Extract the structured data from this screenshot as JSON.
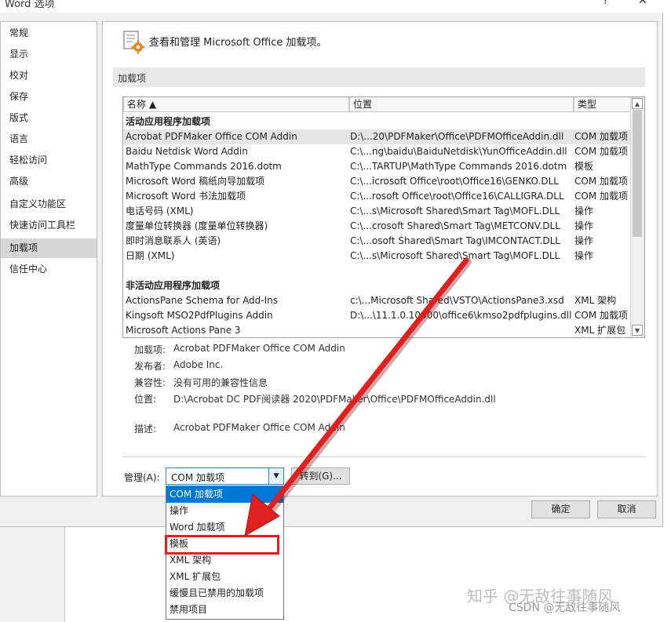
{
  "window": {
    "title": "Word 选项",
    "help": "?",
    "close": "✕"
  },
  "nav": {
    "items": [
      {
        "label": "常规"
      },
      {
        "label": "显示"
      },
      {
        "label": "校对"
      },
      {
        "label": "保存"
      },
      {
        "label": "版式"
      },
      {
        "label": "语言"
      },
      {
        "label": "轻松访问"
      },
      {
        "label": "高级"
      },
      {
        "label": "自定义功能区"
      },
      {
        "label": "快速访问工具栏"
      },
      {
        "label": "加载项"
      },
      {
        "label": "信任中心"
      }
    ],
    "selected": "加载项"
  },
  "header": {
    "text": "查看和管理 Microsoft Office 加载项。",
    "icon": "addin-gear-icon"
  },
  "section": {
    "label": "加载项"
  },
  "grid": {
    "columns": [
      "名称 ▲",
      "位置",
      "类型"
    ],
    "rows": [
      {
        "kind": "group",
        "name": "活动应用程序加载项",
        "path": "",
        "type": ""
      },
      {
        "kind": "sel",
        "name": "Acrobat PDFMaker Office COM Addin",
        "path": "D:\\...20\\PDFMaker\\Office\\PDFMOfficeAddin.dll",
        "type": "COM 加载项"
      },
      {
        "kind": "row",
        "name": "Baidu Netdisk Word Addin",
        "path": "C:\\...ng\\baidu\\BaiduNetdisk\\YunOfficeAddin.dll",
        "type": "COM 加载项"
      },
      {
        "kind": "row",
        "name": "MathType Commands 2016.dotm",
        "path": "C:\\...TARTUP\\MathType Commands 2016.dotm",
        "type": "模板"
      },
      {
        "kind": "row",
        "name": "Microsoft Word 稿纸向导加载项",
        "path": "C:\\...icrosoft Office\\root\\Office16\\GENKO.DLL",
        "type": "COM 加载项"
      },
      {
        "kind": "row",
        "name": "Microsoft Word 书法加载项",
        "path": "C:\\...rosoft Office\\root\\Office16\\CALLIGRA.DLL",
        "type": "COM 加载项"
      },
      {
        "kind": "row",
        "name": "电话号码 (XML)",
        "path": "C:\\...s\\Microsoft Shared\\Smart Tag\\MOFL.DLL",
        "type": "操作"
      },
      {
        "kind": "row",
        "name": "度量单位转换器 (度量单位转换器)",
        "path": "C:\\...crosoft Shared\\Smart Tag\\METCONV.DLL",
        "type": "操作"
      },
      {
        "kind": "row",
        "name": "即时消息联系人 (英语)",
        "path": "C:\\...osoft Shared\\Smart Tag\\IMCONTACT.DLL",
        "type": "操作"
      },
      {
        "kind": "row",
        "name": "日期 (XML)",
        "path": "C:\\...s\\Microsoft Shared\\Smart Tag\\MOFL.DLL",
        "type": "操作"
      },
      {
        "kind": "blank",
        "name": "",
        "path": "",
        "type": ""
      },
      {
        "kind": "group",
        "name": "非活动应用程序加载项",
        "path": "",
        "type": ""
      },
      {
        "kind": "row",
        "name": "ActionsPane Schema for Add-Ins",
        "path": "c:\\...Microsoft Shared\\VSTO\\ActionsPane3.xsd",
        "type": "XML 架构"
      },
      {
        "kind": "row",
        "name": "Kingsoft MSO2PdfPlugins Addin",
        "path": "D:\\...\\11.1.0.10000\\office6\\kmso2pdfplugins.dll",
        "type": "COM 加载项"
      },
      {
        "kind": "row",
        "name": "Microsoft Actions Pane 3",
        "path": "",
        "type": "XML 扩展包"
      }
    ]
  },
  "details": {
    "addin_label": "加载项:",
    "addin_value": "Acrobat PDFMaker Office COM Addin",
    "publisher_label": "发布者:",
    "publisher_value": "Adobe Inc.",
    "compat_label": "兼容性:",
    "compat_value": "没有可用的兼容性信息",
    "location_label": "位置:",
    "location_value": "D:\\Acrobat DC PDF阅读器 2020\\PDFMaker\\Office\\PDFMOfficeAddin.dll",
    "desc_label": "描述:",
    "desc_value": "Acrobat PDFMaker Office COM Addin"
  },
  "manage": {
    "label": "管理(A):",
    "selected": "COM 加载项",
    "go_button": "转到(G)...",
    "options": [
      "COM 加载项",
      "操作",
      "Word 加载项",
      "模板",
      "XML 架构",
      "XML 扩展包",
      "缓慢且已禁用的加载项",
      "禁用项目"
    ]
  },
  "buttons": {
    "ok": "确定",
    "cancel": "取消"
  },
  "annotation": {
    "highlighted_option": "模板",
    "arrow_color": "#e01f1f"
  },
  "watermarks": {
    "zhihu": "知乎 @无敌往事随风",
    "csdn": "CSDN @无敌往事随风"
  }
}
